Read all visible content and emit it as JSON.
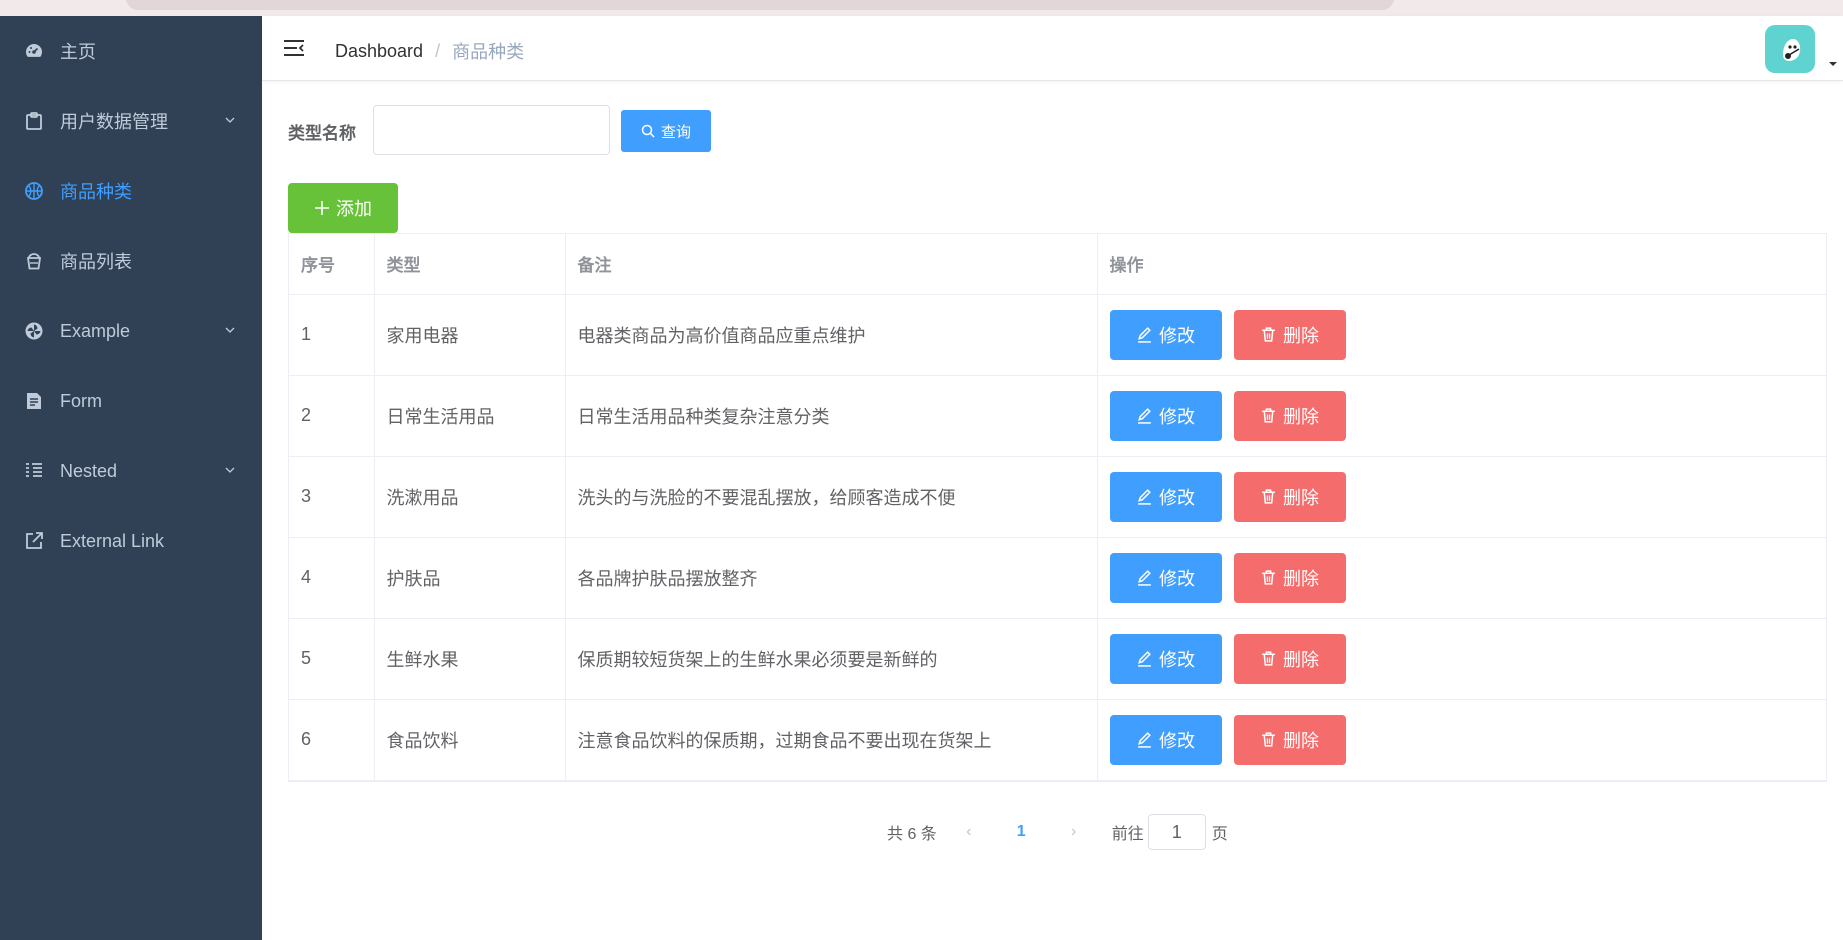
{
  "sidebar": {
    "items": [
      {
        "label": "主页",
        "icon": "dashboard-icon"
      },
      {
        "label": "用户数据管理",
        "icon": "clipboard-icon"
      },
      {
        "label": "商品种类",
        "icon": "basketball-icon"
      },
      {
        "label": "商品列表",
        "icon": "cup-icon"
      },
      {
        "label": "Example",
        "icon": "pinwheel-icon"
      },
      {
        "label": "Form",
        "icon": "form-icon"
      },
      {
        "label": "Nested",
        "icon": "nested-icon"
      },
      {
        "label": "External Link",
        "icon": "external-link-icon"
      }
    ],
    "active_color": "#409eff",
    "bg_color": "#304156"
  },
  "navbar": {
    "breadcrumb_home": "Dashboard",
    "breadcrumb_sep": "/",
    "breadcrumb_current": "商品种类"
  },
  "search": {
    "label": "类型名称",
    "input_value": "",
    "query_label": "查询"
  },
  "toolbar": {
    "add_label": "添加"
  },
  "table": {
    "headers": [
      "序号",
      "类型",
      "备注",
      "操作"
    ],
    "rows": [
      {
        "no": "1",
        "type": "家用电器",
        "note": "电器类商品为高价值商品应重点维护"
      },
      {
        "no": "2",
        "type": "日常生活用品",
        "note": "日常生活用品种类复杂注意分类"
      },
      {
        "no": "3",
        "type": "洗漱用品",
        "note": "洗头的与洗脸的不要混乱摆放，给顾客造成不便"
      },
      {
        "no": "4",
        "type": "护肤品",
        "note": "各品牌护肤品摆放整齐"
      },
      {
        "no": "5",
        "type": "生鲜水果",
        "note": "保质期较短货架上的生鲜水果必须要是新鲜的"
      },
      {
        "no": "6",
        "type": "食品饮料",
        "note": "注意食品饮料的保质期，过期食品不要出现在货架上"
      }
    ],
    "edit_label": "修改",
    "delete_label": "删除"
  },
  "pagination": {
    "total_text": "共 6 条",
    "current_page": "1",
    "goto_label": "前往",
    "jump_value": "1",
    "page_unit": "页"
  },
  "colors": {
    "primary": "#409eff",
    "success": "#67c23a",
    "danger": "#f56c6c"
  }
}
